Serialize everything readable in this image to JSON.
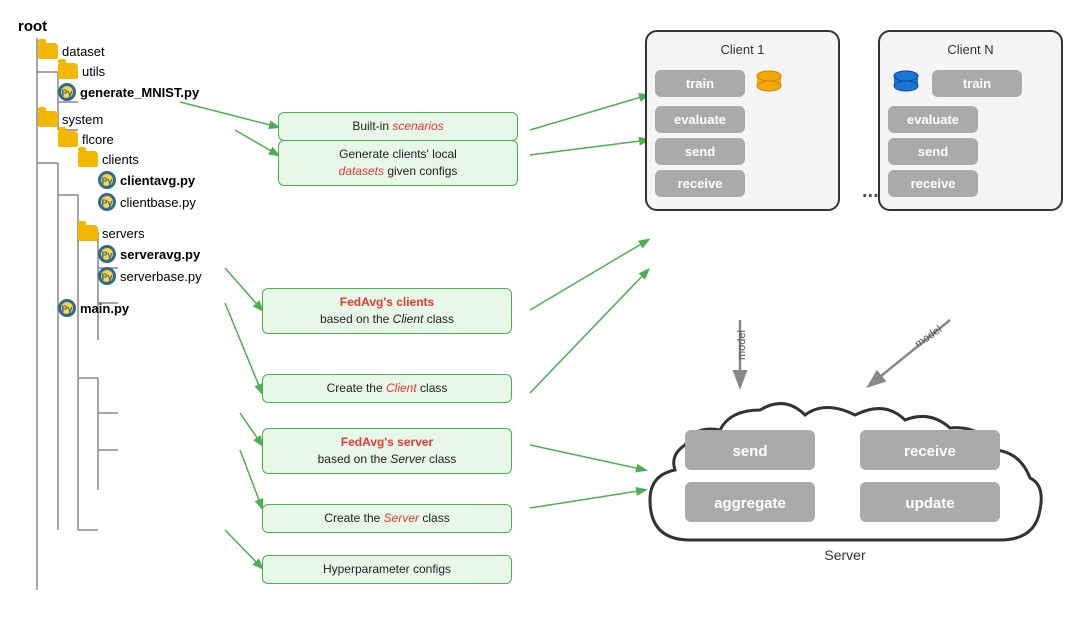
{
  "tree": {
    "root": "root",
    "items": [
      {
        "id": "dataset",
        "label": "dataset",
        "type": "folder",
        "indent": 1
      },
      {
        "id": "utils",
        "label": "utils",
        "type": "folder",
        "indent": 2
      },
      {
        "id": "generate_mnist",
        "label": "generate_MNIST.py",
        "type": "python",
        "bold": true,
        "indent": 2
      },
      {
        "id": "system",
        "label": "system",
        "type": "folder",
        "indent": 1
      },
      {
        "id": "flcore",
        "label": "flcore",
        "type": "folder",
        "indent": 2
      },
      {
        "id": "clients",
        "label": "clients",
        "type": "folder",
        "indent": 3
      },
      {
        "id": "clientavg",
        "label": "clientavg.py",
        "type": "python",
        "bold": true,
        "indent": 4
      },
      {
        "id": "clientbase",
        "label": "clientbase.py",
        "type": "python",
        "bold": false,
        "indent": 4
      },
      {
        "id": "servers",
        "label": "servers",
        "type": "folder",
        "indent": 3
      },
      {
        "id": "serveravg",
        "label": "serveravg.py",
        "type": "python",
        "bold": true,
        "indent": 4
      },
      {
        "id": "serverbase",
        "label": "serverbase.py",
        "type": "python",
        "bold": false,
        "indent": 4
      },
      {
        "id": "main",
        "label": "main.py",
        "type": "python",
        "bold": true,
        "indent": 2
      }
    ]
  },
  "green_boxes": {
    "built_in": "Built-in scenarios",
    "generate_clients": "Generate clients' local\ndatasets given configs",
    "fedavg_clients_line1": "FedAvg's clients",
    "fedavg_clients_line2": "based on the Client class",
    "create_client": "Create the Client class",
    "fedavg_server_line1": "FedAvg's server",
    "fedavg_server_line2": "based on the Server class",
    "create_server": "Create the Server class",
    "hyperparameter": "Hyperparameter configs"
  },
  "clients": {
    "client1_title": "Client 1",
    "clientN_title": "Client N",
    "methods": [
      "train",
      "evaluate",
      "send",
      "receive"
    ]
  },
  "server": {
    "title": "Server",
    "methods": [
      "send",
      "receive",
      "aggregate",
      "update"
    ]
  },
  "arrows": {
    "model_label": "model",
    "model_label2": "model"
  }
}
